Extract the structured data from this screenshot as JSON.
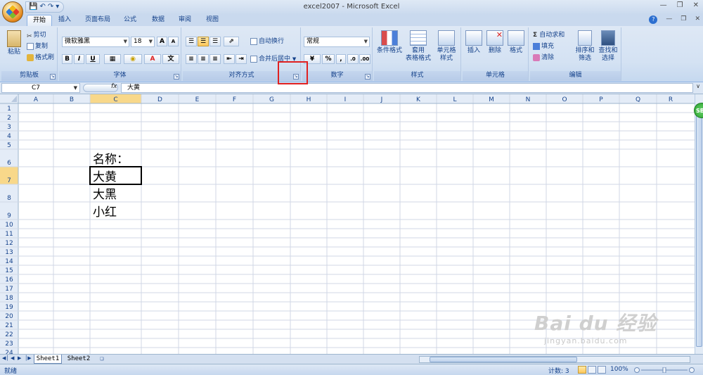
{
  "window": {
    "title": "excel2007 - Microsoft Excel"
  },
  "quick_access": {
    "save_icon": "save-icon",
    "undo_icon": "undo-icon",
    "redo_icon": "redo-icon",
    "customize": "▾"
  },
  "tabs": [
    "开始",
    "插入",
    "页面布局",
    "公式",
    "数据",
    "审阅",
    "视图"
  ],
  "active_tab": "开始",
  "ribbon": {
    "clipboard": {
      "label": "剪贴板",
      "paste": "粘贴",
      "cut": "剪切",
      "copy": "复制",
      "format_painter": "格式刷"
    },
    "font": {
      "label": "字体",
      "font_name": "微软雅黑",
      "font_size": "18",
      "grow": "A",
      "shrink": "A",
      "bold": "B",
      "italic": "I",
      "underline": "U"
    },
    "alignment": {
      "label": "对齐方式",
      "wrap_text": "自动换行",
      "merge_center": "合并后居中"
    },
    "number": {
      "label": "数字",
      "format": "常规",
      "percent": "%",
      "comma": ","
    },
    "styles": {
      "label": "样式",
      "conditional": "条件格式",
      "table_format_1": "套用",
      "table_format_2": "表格格式",
      "cell_styles_1": "单元格",
      "cell_styles_2": "样式"
    },
    "cells": {
      "label": "单元格",
      "insert": "插入",
      "delete": "删除",
      "format": "格式"
    },
    "editing": {
      "label": "编辑",
      "autosum": "自动求和",
      "fill": "填充",
      "clear": "清除",
      "sort_1": "排序和",
      "sort_2": "筛选",
      "find_1": "查找和",
      "find_2": "选择"
    }
  },
  "formula_bar": {
    "name_box": "C7",
    "fx": "fx",
    "value": "大黄"
  },
  "columns": [
    "A",
    "B",
    "C",
    "D",
    "E",
    "F",
    "G",
    "H",
    "I",
    "J",
    "K",
    "L",
    "M",
    "N",
    "O",
    "P",
    "Q",
    "R"
  ],
  "rows": [
    "1",
    "2",
    "3",
    "4",
    "5",
    "6",
    "7",
    "8",
    "9",
    "10",
    "11",
    "12",
    "13",
    "14",
    "15",
    "16",
    "17",
    "18",
    "19",
    "20",
    "21",
    "22",
    "23",
    "24"
  ],
  "cells": [
    {
      "ref": "C6",
      "value": "名称："
    },
    {
      "ref": "C7",
      "value": "大黄"
    },
    {
      "ref": "C8",
      "value": "大黑"
    },
    {
      "ref": "C9",
      "value": "小红"
    }
  ],
  "sheets": [
    "Sheet1",
    "Sheet2"
  ],
  "active_sheet": "Sheet1",
  "status": {
    "ready": "就绪",
    "count": "计数: 3",
    "zoom": "100%"
  },
  "badge": "SB",
  "watermark": {
    "line1": "Bai du 经验",
    "line2": "jingyan.baidu.com"
  }
}
